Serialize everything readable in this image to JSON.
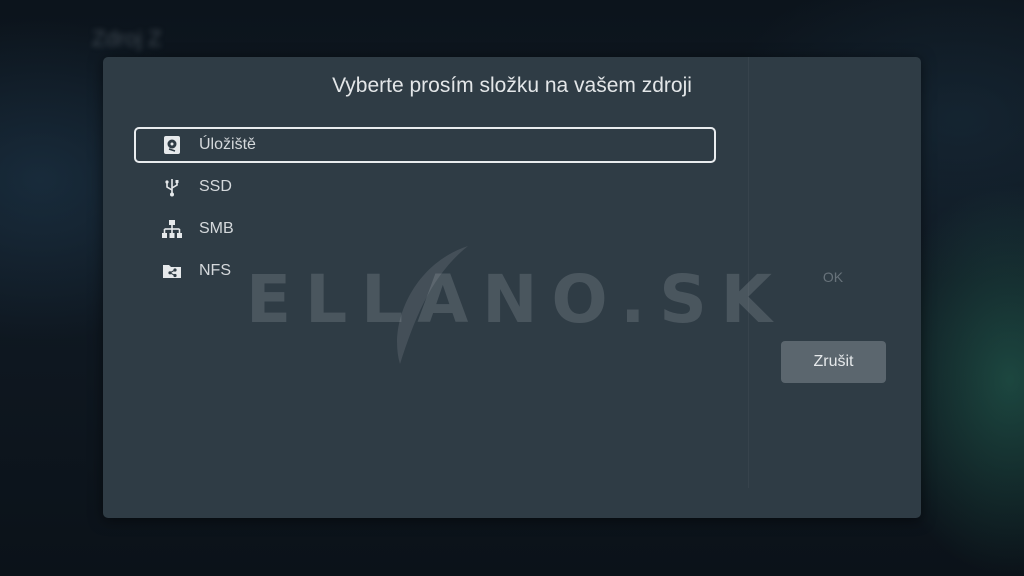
{
  "dialog": {
    "title": "Vyberte prosím složku na vašem zdroji",
    "items": [
      {
        "label": "Úložiště",
        "icon": "storage-icon",
        "selected": true
      },
      {
        "label": "SSD",
        "icon": "usb-icon",
        "selected": false
      },
      {
        "label": "SMB",
        "icon": "network-icon",
        "selected": false
      },
      {
        "label": "NFS",
        "icon": "shared-folder-icon",
        "selected": false
      }
    ],
    "ok_label": "OK",
    "cancel_label": "Zrušit"
  },
  "watermark": {
    "text": "ELLANO.SK"
  },
  "colors": {
    "dialog_bg": "#2f3c45",
    "button_bg": "#5b666e",
    "text": "#d5d9dc"
  }
}
